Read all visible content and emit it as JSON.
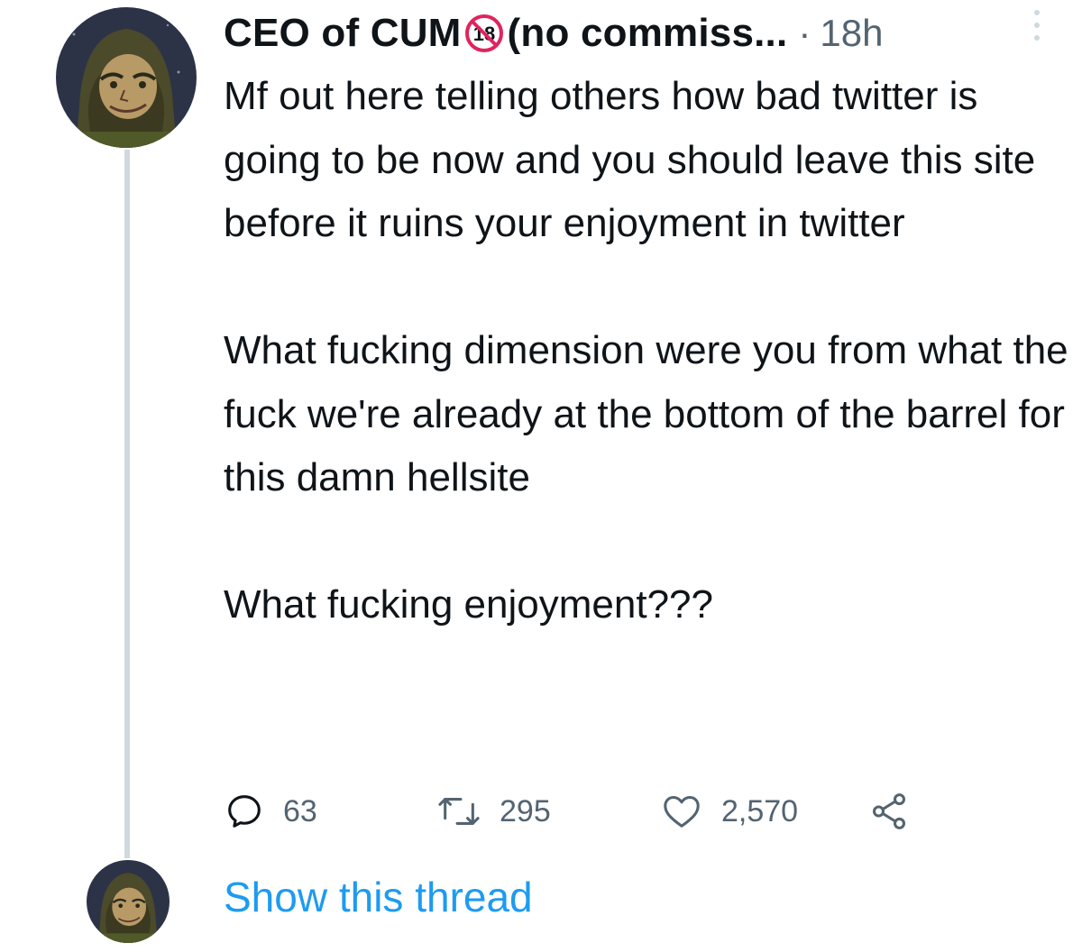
{
  "tweet": {
    "author": {
      "display_name": "CEO of CUM",
      "badge_text": "18",
      "display_name_suffix": "(no commiss...",
      "avatar_icon": "hooded-character-avatar"
    },
    "separator": "·",
    "timestamp": "18h",
    "text_paragraphs": [
      "Mf out here telling others how bad twitter is going to be now and you should leave this site before it ruins your enjoyment in twitter",
      "What fucking dimension were you from what the fuck we're already at the bottom of the barrel for this damn hellsite",
      "What fucking enjoyment???"
    ],
    "actions": {
      "replies": "63",
      "retweets": "295",
      "likes": "2,570"
    },
    "show_thread_label": "Show this thread"
  },
  "colors": {
    "text": "#0f1419",
    "muted": "#536471",
    "link": "#1d9bf0",
    "thread_line": "#cfd9de",
    "badge_red": "#e0245e"
  }
}
